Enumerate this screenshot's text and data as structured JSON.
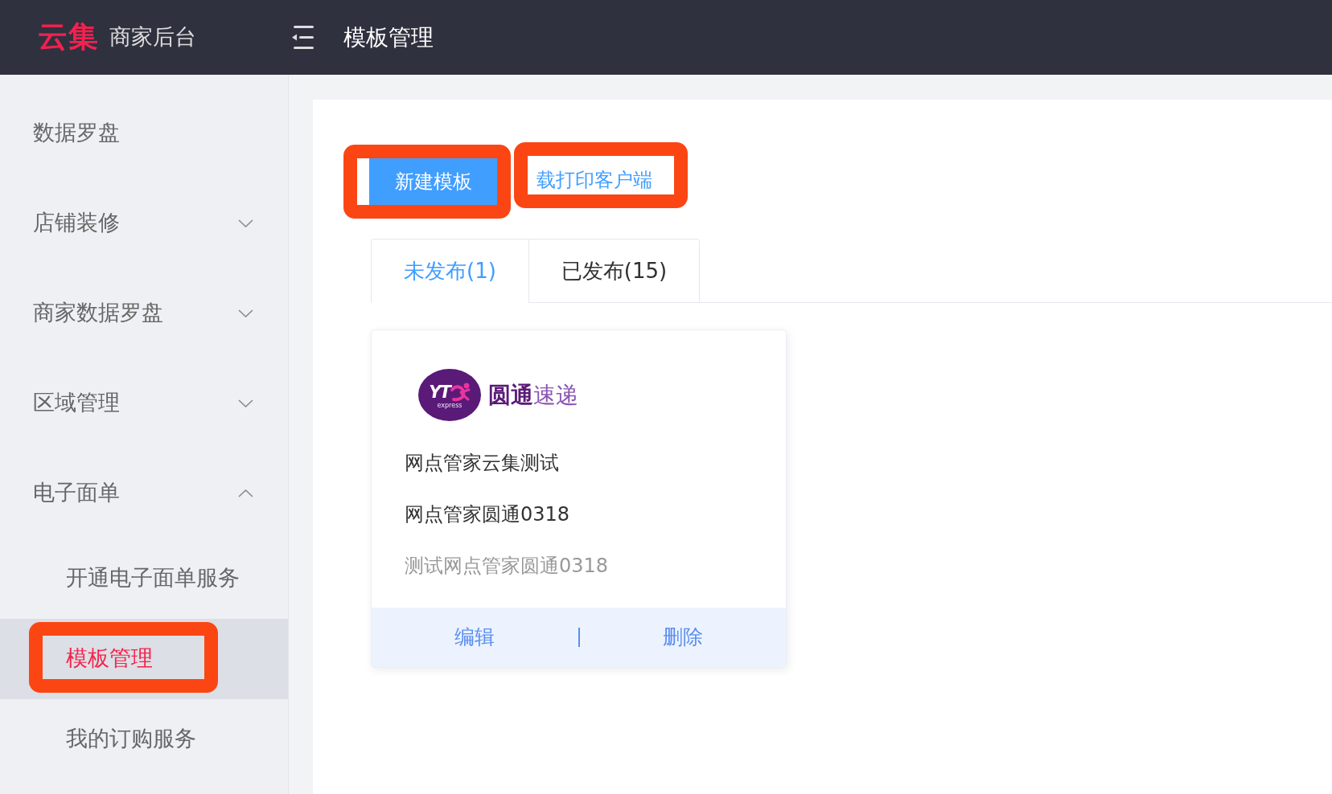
{
  "header": {
    "logo": {
      "brand": "云集",
      "subtitle": "商家后台"
    },
    "title": "模板管理"
  },
  "sidebar": {
    "items": [
      {
        "kind": "link",
        "label": "数据罗盘",
        "selected": false
      },
      {
        "kind": "group",
        "label": "店铺装修",
        "expanded": false,
        "selected": false
      },
      {
        "kind": "group",
        "label": "商家数据罗盘",
        "expanded": false,
        "selected": false
      },
      {
        "kind": "group",
        "label": "区域管理",
        "expanded": false,
        "selected": false
      },
      {
        "kind": "group",
        "label": "电子面单",
        "expanded": true,
        "selected": false,
        "children": [
          {
            "label": "开通电子面单服务",
            "selected": false,
            "highlighted": false
          },
          {
            "label": "模板管理",
            "selected": true,
            "highlighted": true
          },
          {
            "label": "我的订购服务",
            "selected": false,
            "highlighted": false
          }
        ]
      }
    ]
  },
  "toolbar": {
    "buttons": [
      {
        "kind": "primary",
        "label": "新建模板",
        "highlighted": true
      },
      {
        "kind": "link",
        "label": "载打印客户端",
        "highlighted": true
      }
    ]
  },
  "tabs": [
    {
      "label": "未发布(1)",
      "selected": true
    },
    {
      "label": "已发布(15)",
      "selected": false
    }
  ],
  "templates": [
    {
      "logo": {
        "mark": "YT",
        "tagline": "express",
        "name": "**圆通**速递"
      },
      "lines": [
        {
          "kind": "primary",
          "text": "网点管家云集测试"
        },
        {
          "kind": "primary",
          "text": "网点管家圆通0318"
        },
        {
          "kind": "secondary",
          "text": "测试网点管家圆通0318"
        }
      ],
      "actions": [
        "编辑",
        "删除"
      ]
    }
  ]
}
